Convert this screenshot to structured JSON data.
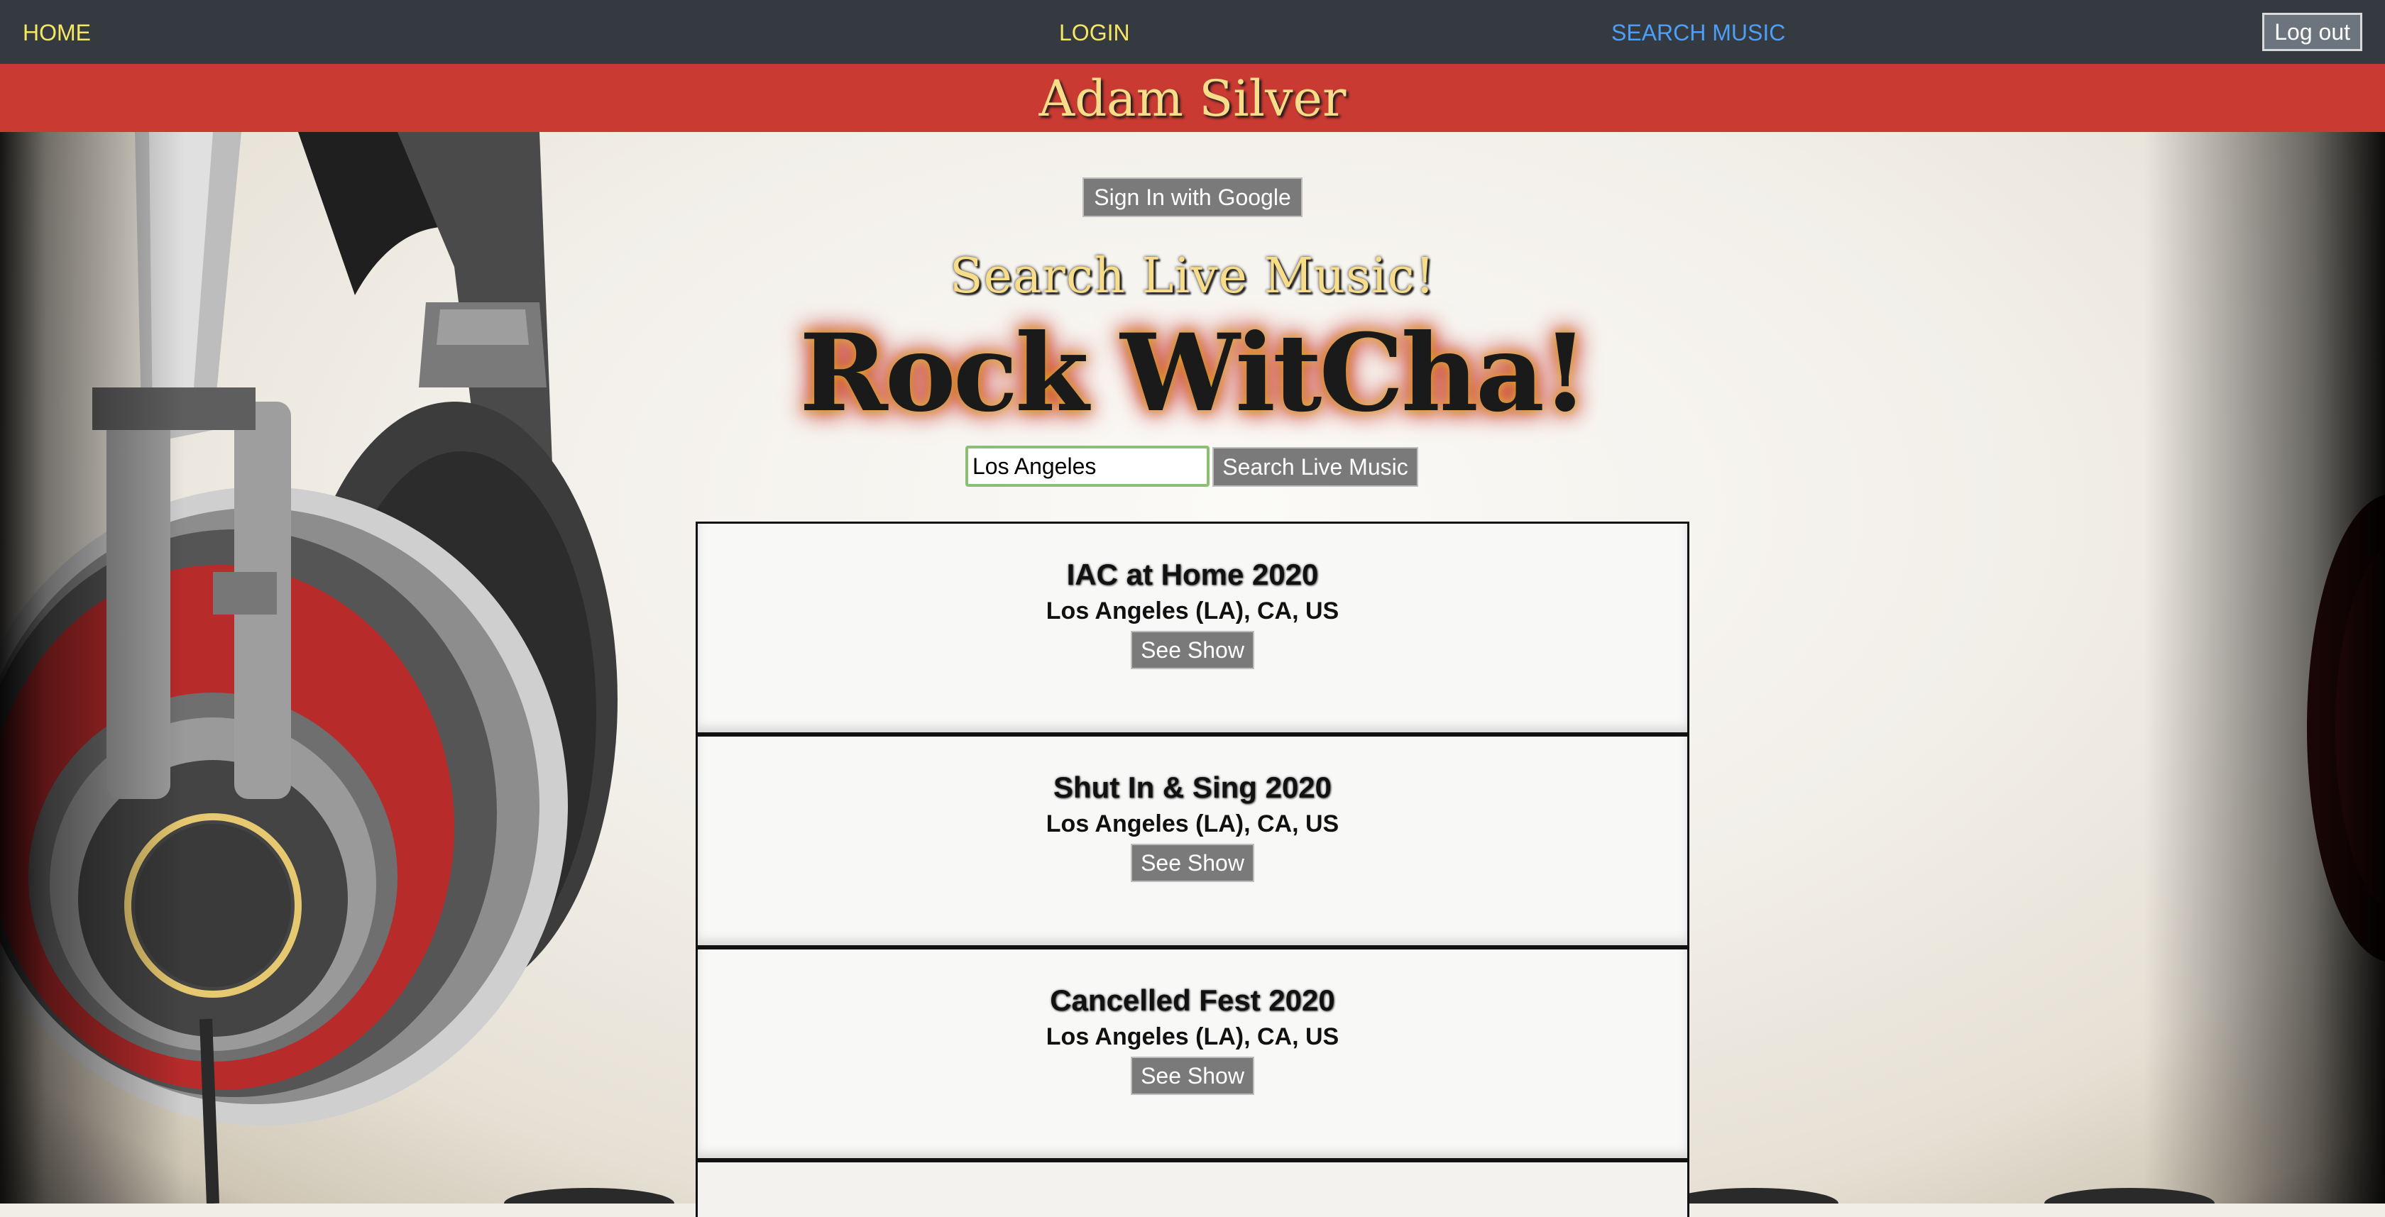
{
  "nav": {
    "home": "HOME",
    "login": "LOGIN",
    "search_music": "SEARCH MUSIC",
    "logout": "Log out"
  },
  "banner": {
    "user_name": "Adam Silver"
  },
  "auth": {
    "google_button": "Sign In with Google"
  },
  "hero": {
    "subtitle": "Search Live Music!",
    "title": "Rock WitCha!"
  },
  "search": {
    "value": "Los Angeles",
    "button": "Search Live Music"
  },
  "results": [
    {
      "name": "IAC at Home 2020",
      "location": "Los Angeles (LA), CA, US",
      "button": "See Show"
    },
    {
      "name": "Shut In & Sing 2020",
      "location": "Los Angeles (LA), CA, US",
      "button": "See Show"
    },
    {
      "name": "Cancelled Fest 2020",
      "location": "Los Angeles (LA), CA, US",
      "button": "See Show"
    }
  ],
  "colors": {
    "navbar": "#343a40",
    "nav_link": "#f5e663",
    "nav_active": "#4d9ef7",
    "banner": "#c83a32",
    "button_gray": "#7a7a7a"
  },
  "icons": [
    "headphones-illustration"
  ]
}
